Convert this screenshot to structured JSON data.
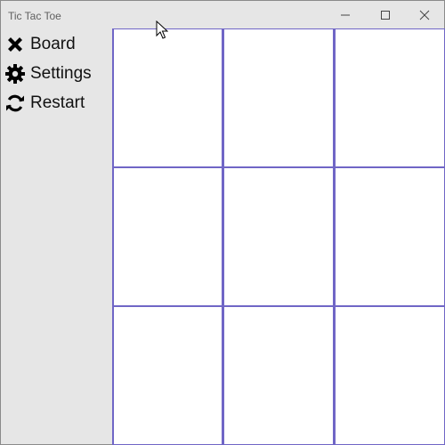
{
  "window": {
    "title": "Tic Tac Toe",
    "controls": [
      "minimize-icon",
      "maximize-icon",
      "close-icon"
    ]
  },
  "sidebar": {
    "items": [
      {
        "label": "Board",
        "icon": "close-x-icon"
      },
      {
        "label": "Settings",
        "icon": "gear-icon"
      },
      {
        "label": "Restart",
        "icon": "refresh-icon"
      }
    ]
  },
  "board": {
    "grid_color": "#7066c6",
    "cells": [
      "",
      "",
      "",
      "",
      "",
      "",
      "",
      "",
      ""
    ]
  }
}
